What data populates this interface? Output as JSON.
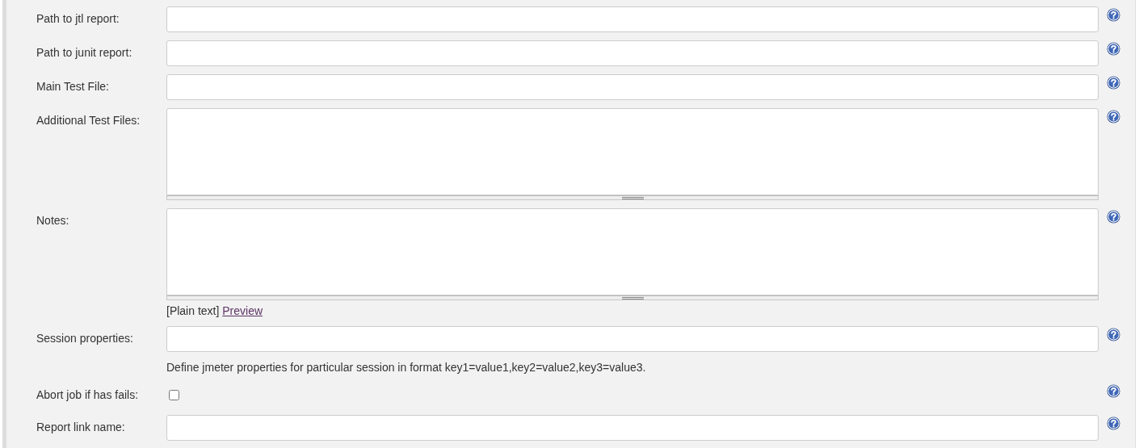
{
  "rows": [
    {
      "kind": "text",
      "label": "Path to jtl report:"
    },
    {
      "kind": "text",
      "label": "Path to junit report:"
    },
    {
      "kind": "text",
      "label": "Main Test File:"
    },
    {
      "kind": "textarea",
      "label": "Additional Test Files:"
    },
    {
      "kind": "textarea",
      "label": "Notes:",
      "format": "[Plain text]",
      "preview_link": "Preview"
    },
    {
      "kind": "text",
      "label": "Session properties:",
      "description": "Define jmeter properties for particular session in format key1=value1,key2=value2,key3=value3."
    },
    {
      "kind": "checkbox",
      "label": "Abort job if has fails:",
      "checked": false
    },
    {
      "kind": "text",
      "label": "Report link name:"
    }
  ]
}
